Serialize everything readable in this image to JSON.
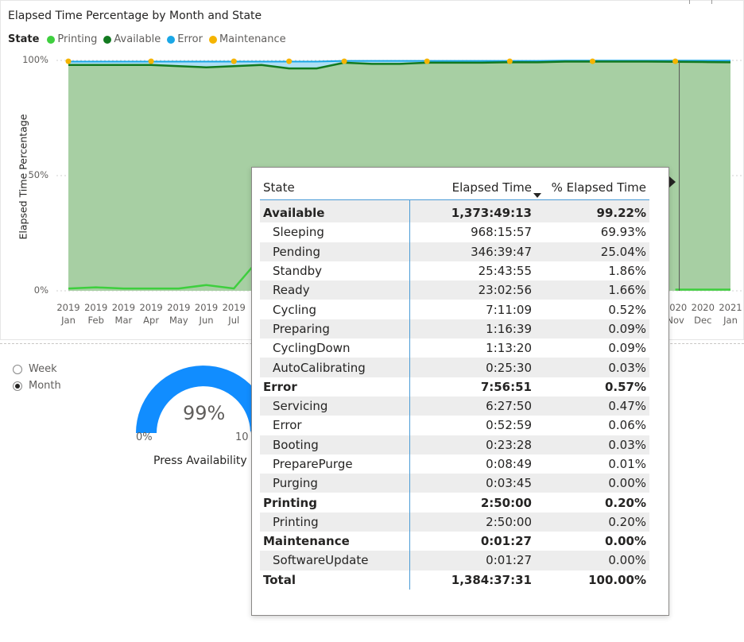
{
  "chart_data": {
    "type": "area",
    "title": "Elapsed Time Percentage by Month and State",
    "ylabel": "Elapsed Time Percentage",
    "xlabel": "",
    "legend": {
      "title": "State",
      "placement": "top-left",
      "entries": [
        {
          "name": "Printing",
          "color": "#3ecf3e"
        },
        {
          "name": "Available",
          "color": "#127a20"
        },
        {
          "name": "Error",
          "color": "#1aa7e6"
        },
        {
          "name": "Maintenance",
          "color": "#f5b400"
        }
      ]
    },
    "yticks": [
      "100%",
      "50%",
      "0%"
    ],
    "ylim": [
      0,
      100
    ],
    "categories": [
      {
        "year": "2019",
        "month": "Jan"
      },
      {
        "year": "2019",
        "month": "Feb"
      },
      {
        "year": "2019",
        "month": "Mar"
      },
      {
        "year": "2019",
        "month": "Apr"
      },
      {
        "year": "2019",
        "month": "May"
      },
      {
        "year": "2019",
        "month": "Jun"
      },
      {
        "year": "2019",
        "month": "Jul"
      },
      {
        "year": "",
        "month": ""
      },
      {
        "year": "",
        "month": ""
      },
      {
        "year": "",
        "month": ""
      },
      {
        "year": "",
        "month": ""
      },
      {
        "year": "",
        "month": ""
      },
      {
        "year": "",
        "month": ""
      },
      {
        "year": "",
        "month": ""
      },
      {
        "year": "",
        "month": ""
      },
      {
        "year": "",
        "month": ""
      },
      {
        "year": "",
        "month": ""
      },
      {
        "year": "",
        "month": ""
      },
      {
        "year": "",
        "month": ""
      },
      {
        "year": "",
        "month": ""
      },
      {
        "year": "",
        "month": ""
      },
      {
        "year": "",
        "month": ""
      },
      {
        "year": "2020",
        "month": "Nov"
      },
      {
        "year": "2020",
        "month": "Dec"
      },
      {
        "year": "2021",
        "month": "Jan"
      }
    ],
    "series": [
      {
        "name": "Printing",
        "color": "#3ecf3e",
        "values": [
          1,
          1.5,
          1,
          1,
          1,
          2.5,
          1,
          15,
          null,
          null,
          null,
          null,
          null,
          null,
          null,
          null,
          null,
          null,
          null,
          null,
          null,
          null,
          0.5,
          0.5,
          0.5
        ]
      },
      {
        "name": "Available",
        "color": "#127a20",
        "values": [
          98,
          98,
          98,
          98,
          97.5,
          97,
          97.5,
          98,
          96.5,
          96.5,
          99,
          98.5,
          98.5,
          99,
          99,
          99,
          99.2,
          99.2,
          99.5,
          99.5,
          99.5,
          99.5,
          99.4,
          99.3,
          99.2
        ]
      },
      {
        "name": "Error",
        "color": "#1aa7e6",
        "values": [
          1.5,
          1.5,
          1.5,
          1.5,
          2,
          2.5,
          2,
          1.5,
          3,
          3,
          0.8,
          1.3,
          1.3,
          0.8,
          0.8,
          0.8,
          0.6,
          0.6,
          0.4,
          0.4,
          0.4,
          0.4,
          0.5,
          0.6,
          0.7
        ]
      },
      {
        "name": "Maintenance",
        "color": "#f5b400",
        "values": [
          0.5,
          null,
          null,
          0.5,
          null,
          null,
          0.5,
          null,
          0.5,
          null,
          0.5,
          null,
          null,
          0.5,
          null,
          null,
          0.5,
          null,
          null,
          0.5,
          null,
          null,
          0.5,
          null,
          null
        ]
      }
    ],
    "highlight_category_index": 22
  },
  "tooltip": {
    "headers": [
      "State",
      "Elapsed Time",
      "% Elapsed Time"
    ],
    "rows": [
      {
        "state": "Available",
        "elapsed": "1,373:49:13",
        "pct": "99.22%",
        "group": true
      },
      {
        "state": "Sleeping",
        "elapsed": "968:15:57",
        "pct": "69.93%",
        "group": false
      },
      {
        "state": "Pending",
        "elapsed": "346:39:47",
        "pct": "25.04%",
        "group": false
      },
      {
        "state": "Standby",
        "elapsed": "25:43:55",
        "pct": "1.86%",
        "group": false
      },
      {
        "state": "Ready",
        "elapsed": "23:02:56",
        "pct": "1.66%",
        "group": false
      },
      {
        "state": "Cycling",
        "elapsed": "7:11:09",
        "pct": "0.52%",
        "group": false
      },
      {
        "state": "Preparing",
        "elapsed": "1:16:39",
        "pct": "0.09%",
        "group": false
      },
      {
        "state": "CyclingDown",
        "elapsed": "1:13:20",
        "pct": "0.09%",
        "group": false
      },
      {
        "state": "AutoCalibrating",
        "elapsed": "0:25:30",
        "pct": "0.03%",
        "group": false
      },
      {
        "state": "Error",
        "elapsed": "7:56:51",
        "pct": "0.57%",
        "group": true
      },
      {
        "state": "Servicing",
        "elapsed": "6:27:50",
        "pct": "0.47%",
        "group": false
      },
      {
        "state": "Error",
        "elapsed": "0:52:59",
        "pct": "0.06%",
        "group": false
      },
      {
        "state": "Booting",
        "elapsed": "0:23:28",
        "pct": "0.03%",
        "group": false
      },
      {
        "state": "PreparePurge",
        "elapsed": "0:08:49",
        "pct": "0.01%",
        "group": false
      },
      {
        "state": "Purging",
        "elapsed": "0:03:45",
        "pct": "0.00%",
        "group": false
      },
      {
        "state": "Printing",
        "elapsed": "2:50:00",
        "pct": "0.20%",
        "group": true
      },
      {
        "state": "Printing",
        "elapsed": "2:50:00",
        "pct": "0.20%",
        "group": false
      },
      {
        "state": "Maintenance",
        "elapsed": "0:01:27",
        "pct": "0.00%",
        "group": true
      },
      {
        "state": "SoftwareUpdate",
        "elapsed": "0:01:27",
        "pct": "0.00%",
        "group": false
      }
    ],
    "total": {
      "state": "Total",
      "elapsed": "1,384:37:31",
      "pct": "100.00%"
    }
  },
  "slicer": {
    "options": [
      "Week",
      "Month"
    ],
    "selected": "Month"
  },
  "gauge": {
    "value_text": "99%",
    "value": 99,
    "min": "0%",
    "max": "10",
    "label": "Press Availability",
    "color": "#118dff",
    "track_color": "#e6e6e6"
  }
}
